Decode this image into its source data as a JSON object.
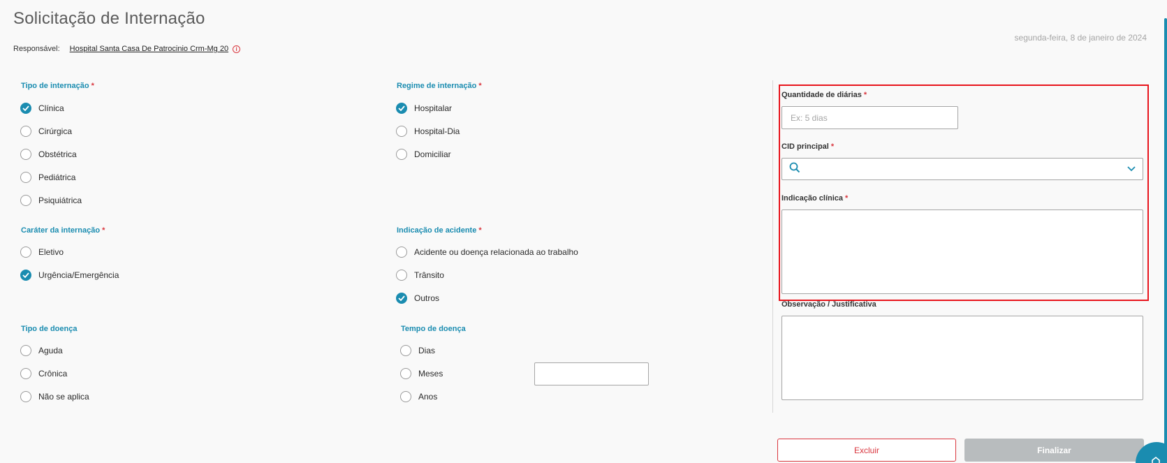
{
  "header": {
    "title": "Solicitação de Internação",
    "responsavel_label": "Responsável:",
    "responsavel_value": "Hospital Santa Casa De Patrocinio Crm-Mg 20",
    "date": "segunda-feira, 8 de janeiro de 2024"
  },
  "tipo_internacao": {
    "label": "Tipo de internação",
    "required": "*",
    "options": [
      {
        "label": "Clínica",
        "checked": true
      },
      {
        "label": "Cirúrgica",
        "checked": false
      },
      {
        "label": "Obstétrica",
        "checked": false
      },
      {
        "label": "Pediátrica",
        "checked": false
      },
      {
        "label": "Psiquiátrica",
        "checked": false
      }
    ]
  },
  "regime_internacao": {
    "label": "Regime de internação",
    "required": "*",
    "options": [
      {
        "label": "Hospitalar",
        "checked": true
      },
      {
        "label": "Hospital-Dia",
        "checked": false
      },
      {
        "label": "Domiciliar",
        "checked": false
      }
    ]
  },
  "carater_internacao": {
    "label": "Caráter da internação",
    "required": "*",
    "options": [
      {
        "label": "Eletivo",
        "checked": false
      },
      {
        "label": "Urgência/Emergência",
        "checked": true
      }
    ]
  },
  "indicacao_acidente": {
    "label": "Indicação de acidente",
    "required": "*",
    "options": [
      {
        "label": "Acidente ou doença relacionada ao trabalho",
        "checked": false
      },
      {
        "label": "Trânsito",
        "checked": false
      },
      {
        "label": "Outros",
        "checked": true
      }
    ]
  },
  "tipo_doenca": {
    "label": "Tipo de doença",
    "options": [
      {
        "label": "Aguda",
        "checked": false
      },
      {
        "label": "Crônica",
        "checked": false
      },
      {
        "label": "Não se aplica",
        "checked": false
      }
    ]
  },
  "tempo_doenca": {
    "label": "Tempo de doença",
    "options": [
      {
        "label": "Dias",
        "checked": false
      },
      {
        "label": "Meses",
        "checked": false
      },
      {
        "label": "Anos",
        "checked": false
      }
    ],
    "value": ""
  },
  "form": {
    "qtd_diarias_label": "Quantidade de diárias",
    "qtd_diarias_placeholder": "Ex: 5 dias",
    "qtd_diarias_value": "",
    "cid_label": "CID principal",
    "cid_value": "",
    "indicacao_clinica_label": "Indicação clínica",
    "indicacao_clinica_value": "",
    "observacao_label": "Observação / Justificativa",
    "observacao_value": "",
    "required": "*"
  },
  "actions": {
    "excluir_label": "Excluir",
    "finalizar_label": "Finalizar"
  },
  "colors": {
    "accent": "#1a8cb0",
    "danger": "#d9363e",
    "highlight": "#e8141c",
    "disabled": "#b8bcbe"
  }
}
